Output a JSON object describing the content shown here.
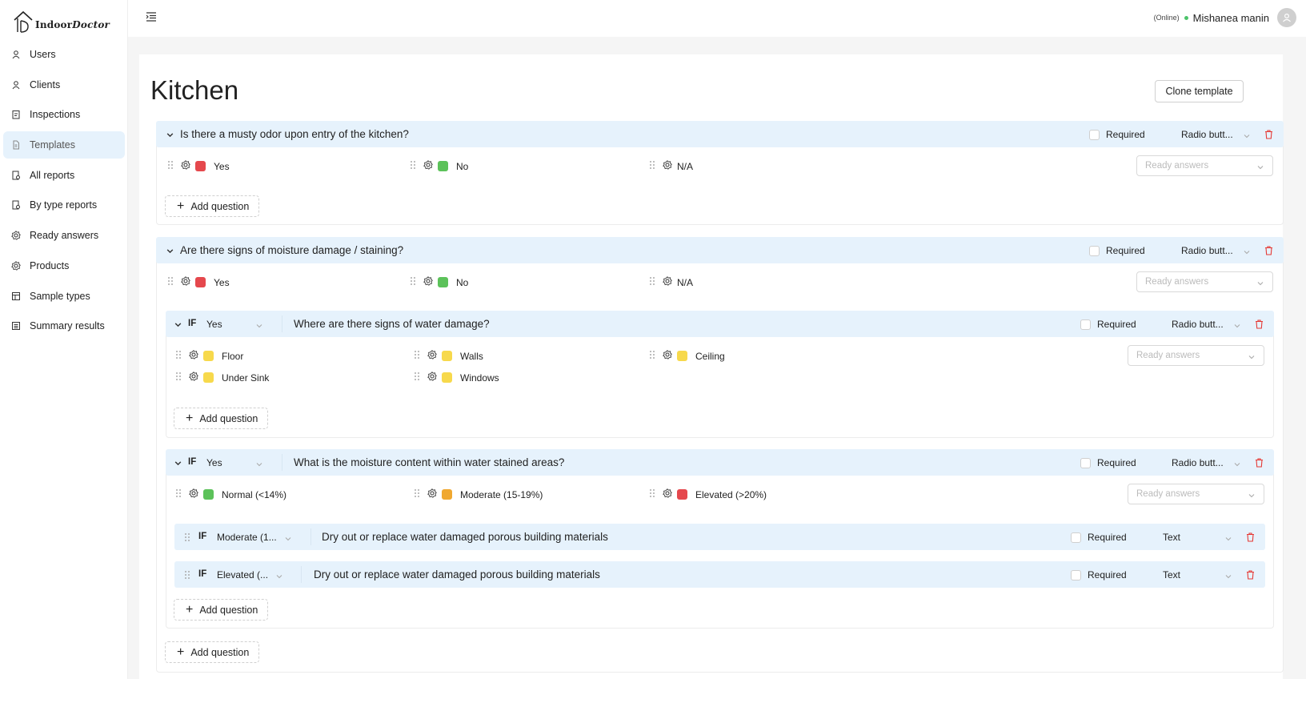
{
  "brand": {
    "logo_text_bold": "Indoor",
    "logo_text_italic": "Doctor"
  },
  "sidebar": {
    "items": [
      {
        "label": "Users",
        "icon": "user-icon"
      },
      {
        "label": "Clients",
        "icon": "user-icon"
      },
      {
        "label": "Inspections",
        "icon": "clipboard-icon"
      },
      {
        "label": "Templates",
        "icon": "document-icon",
        "active": true
      },
      {
        "label": "All reports",
        "icon": "report-icon"
      },
      {
        "label": "By type reports",
        "icon": "report-icon"
      },
      {
        "label": "Ready answers",
        "icon": "gear-icon"
      },
      {
        "label": "Products",
        "icon": "gear-icon"
      },
      {
        "label": "Sample types",
        "icon": "table-icon"
      },
      {
        "label": "Summary results",
        "icon": "list-icon"
      }
    ]
  },
  "header": {
    "status": "(Online)",
    "user_name": "Mishanea manin"
  },
  "page": {
    "title": "Kitchen",
    "clone_label": "Clone template"
  },
  "common": {
    "required": "Required",
    "ready_placeholder": "Ready answers",
    "add_question": "Add question",
    "if_label": "IF"
  },
  "q1": {
    "text": "Is there a musty odor upon entry of the kitchen?",
    "type": "Radio butt...",
    "options": [
      {
        "label": "Yes",
        "color": "#e5484d"
      },
      {
        "label": "No",
        "color": "#5cc25a"
      },
      {
        "label": "N/A",
        "color": ""
      }
    ]
  },
  "q2": {
    "text": "Are there signs of moisture damage / staining?",
    "type": "Radio butt...",
    "options": [
      {
        "label": "Yes",
        "color": "#e5484d"
      },
      {
        "label": "No",
        "color": "#5cc25a"
      },
      {
        "label": "N/A",
        "color": ""
      }
    ]
  },
  "q2a": {
    "if_value": "Yes",
    "text": "Where are there signs of water damage?",
    "type": "Radio butt...",
    "options": [
      {
        "label": "Floor",
        "color": "#f7d94c"
      },
      {
        "label": "Walls",
        "color": "#f7d94c"
      },
      {
        "label": "Ceiling",
        "color": "#f7d94c"
      },
      {
        "label": "Under Sink",
        "color": "#f7d94c"
      },
      {
        "label": "Windows",
        "color": "#f7d94c"
      }
    ]
  },
  "q2b": {
    "if_value": "Yes",
    "text": "What is the moisture content within water stained areas?",
    "type": "Radio butt...",
    "options": [
      {
        "label": "Normal (<14%)",
        "color": "#5cc25a"
      },
      {
        "label": "Moderate (15-19%)",
        "color": "#f0a830"
      },
      {
        "label": "Elevated (>20%)",
        "color": "#e5484d"
      }
    ],
    "sub": [
      {
        "if_value": "Moderate (1...",
        "text": "Dry out or replace water damaged porous building materials",
        "type": "Text"
      },
      {
        "if_value": "Elevated (...",
        "text": "Dry out or replace water damaged porous building materials",
        "type": "Text"
      }
    ]
  }
}
